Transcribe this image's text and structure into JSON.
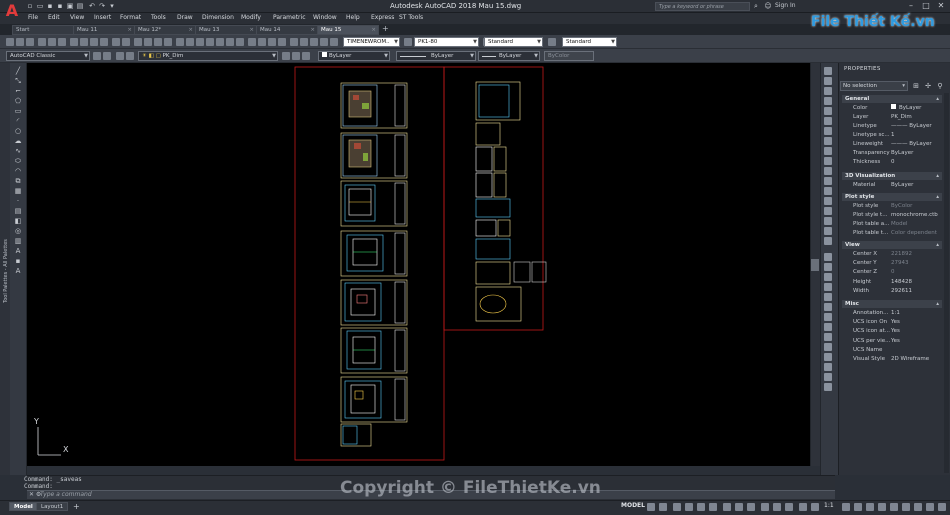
{
  "app": {
    "title": "Autodesk AutoCAD 2018    Mau 15.dwg",
    "search_placeholder": "Type a keyword or phrase",
    "sign_in": "Sign In"
  },
  "menu": [
    "File",
    "Edit",
    "View",
    "Insert",
    "Format",
    "Tools",
    "Draw",
    "Dimension",
    "Modify",
    "Parametric",
    "Window",
    "Help",
    "Express",
    "ST Tools"
  ],
  "tabs": [
    {
      "label": "Start",
      "active": false
    },
    {
      "label": "Mau 11",
      "active": false
    },
    {
      "label": "Mau 12*",
      "active": false
    },
    {
      "label": "Mau 13",
      "active": false
    },
    {
      "label": "Mau 14",
      "active": false
    },
    {
      "label": "Mau 15",
      "active": true
    }
  ],
  "toolbar1": {
    "text_style": "TIMENEWROM..",
    "dim_style": "PK1-80",
    "table_style": "Standard",
    "multileader_style": "Standard"
  },
  "toolbar2": {
    "workspace": "AutoCAD Classic",
    "layer": "PK_Dim",
    "color": "ByLayer",
    "linetype": "ByLayer",
    "lineweight": "ByLayer",
    "plotstyle": "ByColor"
  },
  "palette_label": "Tool Palettes - All Palettes",
  "properties": {
    "title": "PROPERTIES",
    "selection": "No selection",
    "sections": [
      {
        "name": "General",
        "rows": [
          {
            "k": "Color",
            "v": "ByLayer"
          },
          {
            "k": "Layer",
            "v": "PK_Dim"
          },
          {
            "k": "Linetype",
            "v": "——— ByLayer"
          },
          {
            "k": "Linetype sc...",
            "v": "1"
          },
          {
            "k": "Lineweight",
            "v": "——— ByLayer"
          },
          {
            "k": "Transparency",
            "v": "ByLayer"
          },
          {
            "k": "Thickness",
            "v": "0"
          }
        ]
      },
      {
        "name": "3D Visualization",
        "rows": [
          {
            "k": "Material",
            "v": "ByLayer"
          }
        ]
      },
      {
        "name": "Plot style",
        "rows": [
          {
            "k": "Plot style",
            "v": "ByColor",
            "dim": true
          },
          {
            "k": "Plot style t...",
            "v": "monochrome.ctb"
          },
          {
            "k": "Plot table a...",
            "v": "Model",
            "dim": true
          },
          {
            "k": "Plot table t...",
            "v": "Color dependent",
            "dim": true
          }
        ]
      },
      {
        "name": "View",
        "rows": [
          {
            "k": "Center X",
            "v": "221892",
            "dim": true
          },
          {
            "k": "Center Y",
            "v": "27943",
            "dim": true
          },
          {
            "k": "Center Z",
            "v": "0",
            "dim": true
          },
          {
            "k": "Height",
            "v": "148428"
          },
          {
            "k": "Width",
            "v": "292611"
          }
        ]
      },
      {
        "name": "Misc",
        "rows": [
          {
            "k": "Annotation...",
            "v": "1:1"
          },
          {
            "k": "UCS icon On",
            "v": "Yes"
          },
          {
            "k": "UCS icon at...",
            "v": "Yes"
          },
          {
            "k": "UCS per vie...",
            "v": "Yes"
          },
          {
            "k": "UCS Name",
            "v": ""
          },
          {
            "k": "Visual Style",
            "v": "2D Wireframe"
          }
        ]
      }
    ]
  },
  "command": {
    "history": [
      "Command: _saveas",
      "Command:"
    ],
    "placeholder": "Type a command"
  },
  "status": {
    "layouts": [
      {
        "label": "Model",
        "active": true
      },
      {
        "label": "Layout1",
        "active": false
      }
    ],
    "space": "MODEL",
    "scale": "1:1"
  },
  "ucs": {
    "x_label": "X",
    "y_label": "Y"
  },
  "watermark": {
    "logo": "File Thiết Kế.vn",
    "copyright": "Copyright © FileThietKe.vn"
  }
}
